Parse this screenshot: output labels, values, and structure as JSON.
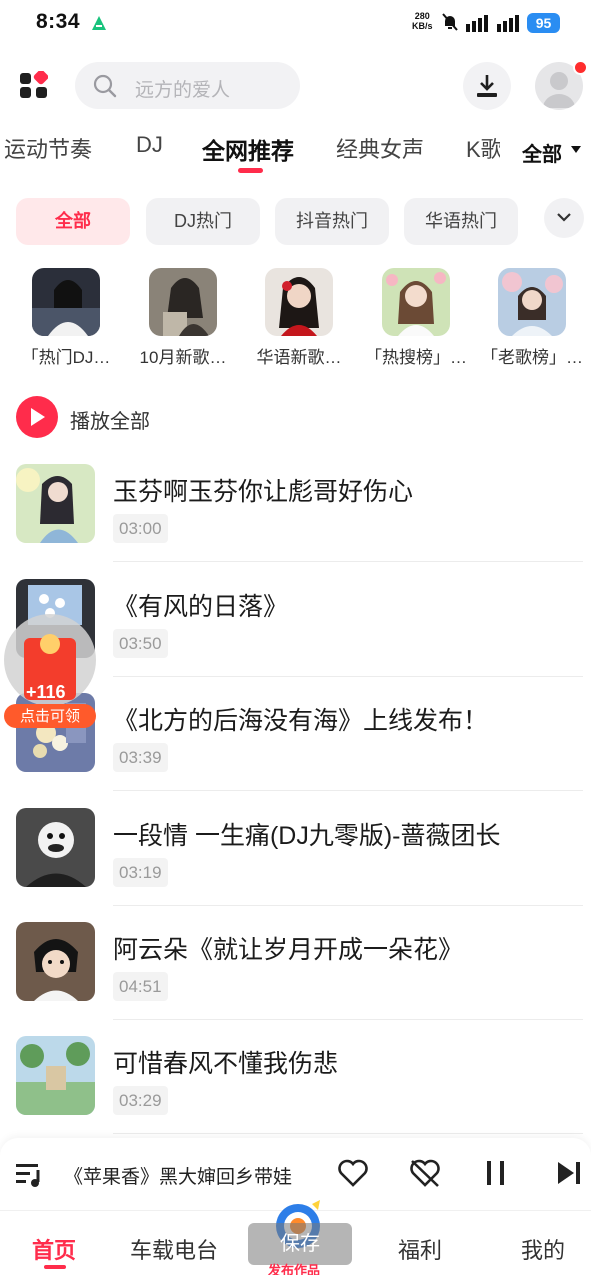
{
  "status_bar": {
    "time": "8:34",
    "net_rate_value": "280",
    "net_rate_unit": "KB/s",
    "battery": "95"
  },
  "header": {
    "search_placeholder": "远方的爱人"
  },
  "category_tabs": {
    "items": [
      "运动节奏",
      "DJ",
      "全网推荐",
      "经典女声",
      "K歌"
    ],
    "active": "全网推荐",
    "all_label": "全部"
  },
  "chips": {
    "items": [
      "全部",
      "DJ热门",
      "抖音热门",
      "华语热门"
    ],
    "active": "全部"
  },
  "playlists": [
    {
      "name": "「热门DJ…"
    },
    {
      "name": "10月新歌…"
    },
    {
      "name": "华语新歌…"
    },
    {
      "name": "「热搜榜」…"
    },
    {
      "name": "「老歌榜」…"
    }
  ],
  "play_all": {
    "label": "播放全部"
  },
  "songs": [
    {
      "title": "玉芬啊玉芬你让彪哥好伤心",
      "duration": "03:00"
    },
    {
      "title": "《有风的日落》",
      "duration": "03:50"
    },
    {
      "title": "《北方的后海没有海》上线发布！",
      "duration": "03:39"
    },
    {
      "title": "一段情 一生痛(DJ九零版)-蔷薇团长",
      "duration": "03:19"
    },
    {
      "title": "阿云朵《就让岁月开成一朵花》",
      "duration": "04:51"
    },
    {
      "title": "可惜春风不懂我伤悲",
      "duration": "03:29"
    }
  ],
  "red_packet": {
    "amount": "+116",
    "claim_label": "点击可领"
  },
  "mini_player": {
    "now_playing": "《苹果香》黑大婶回乡带娃"
  },
  "bottom_nav": {
    "items": [
      "首页",
      "车载电台",
      "福利",
      "我的"
    ],
    "active": "首页",
    "save_label": "保存",
    "publish_label": "发布作品"
  },
  "colors": {
    "accent": "#ff2c4b",
    "battery": "#2a8df2"
  }
}
